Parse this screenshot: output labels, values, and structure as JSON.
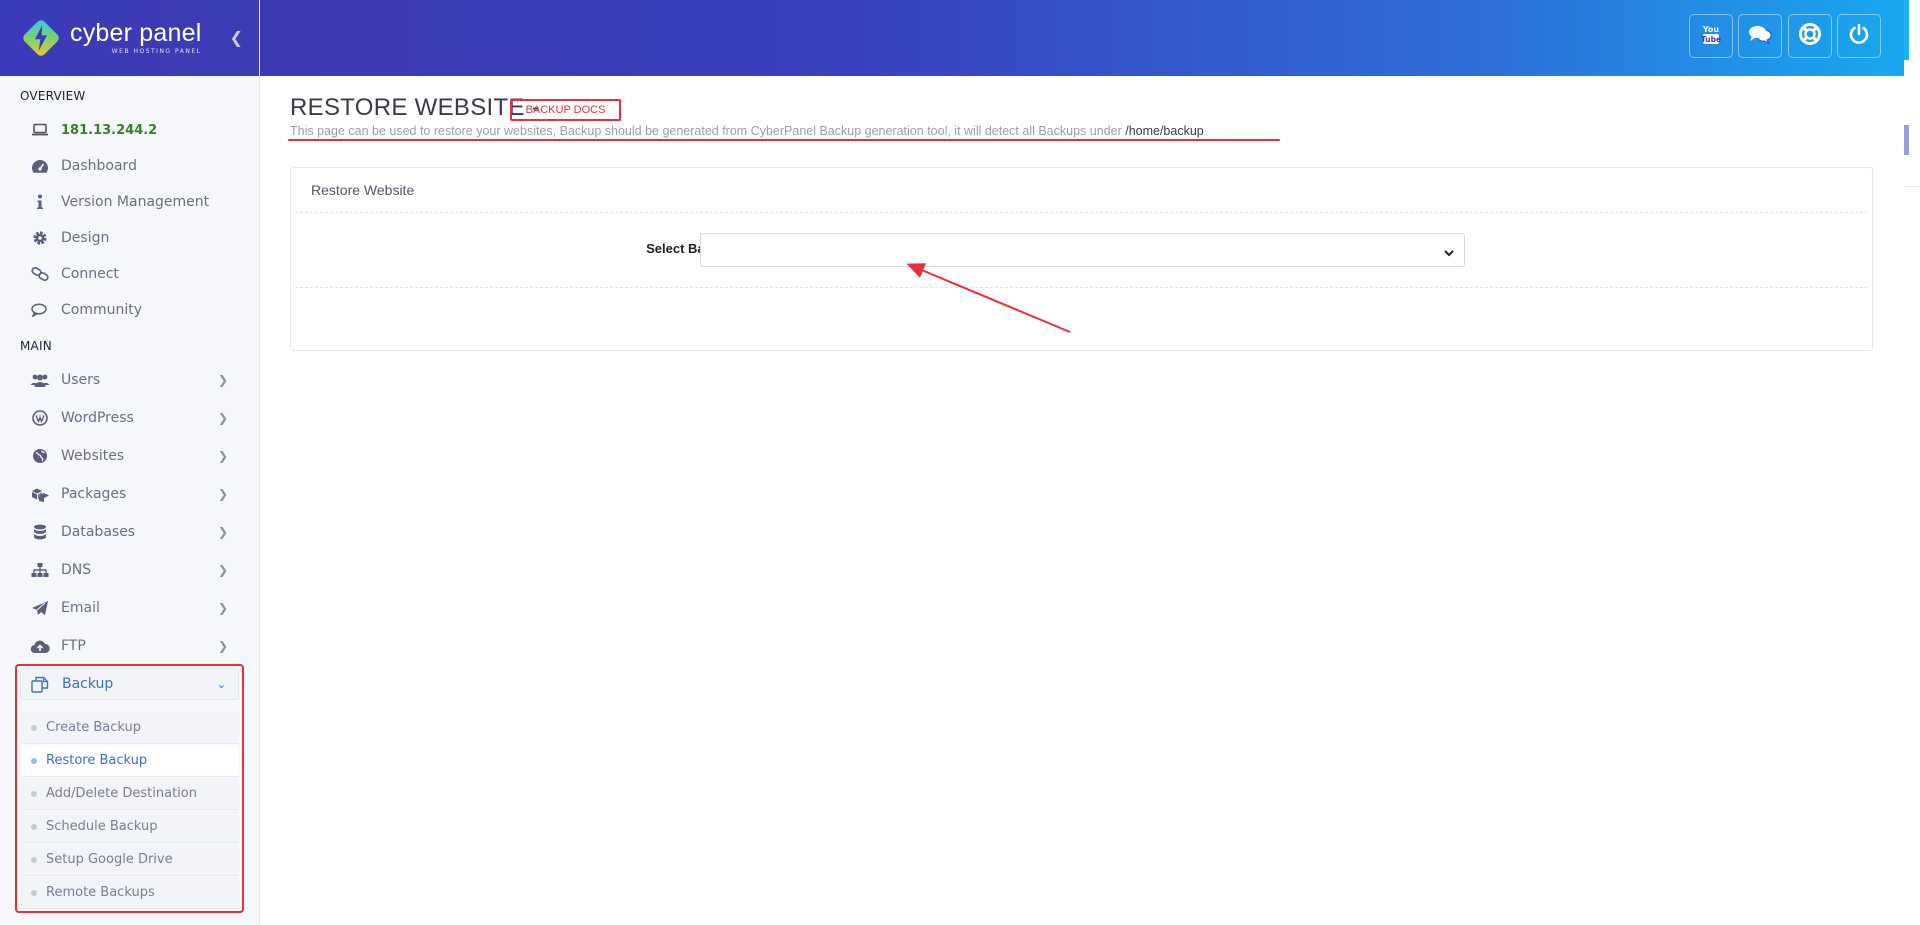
{
  "brand": {
    "title": "cyber panel",
    "subtitle": "WEB HOSTING PANEL",
    "collapse_icon": "chevron-left-icon"
  },
  "sidebar": {
    "overview_label": "OVERVIEW",
    "main_label": "MAIN",
    "ip": "181.13.244.2",
    "overview_items": [
      {
        "label": "Dashboard",
        "icon": "dashboard-icon"
      },
      {
        "label": "Version Management",
        "icon": "info-icon"
      },
      {
        "label": "Design",
        "icon": "gear-icon"
      },
      {
        "label": "Connect",
        "icon": "link-icon"
      },
      {
        "label": "Community",
        "icon": "chat-icon"
      }
    ],
    "main_items": [
      {
        "label": "Users",
        "icon": "users-icon"
      },
      {
        "label": "WordPress",
        "icon": "wordpress-icon"
      },
      {
        "label": "Websites",
        "icon": "globe-icon"
      },
      {
        "label": "Packages",
        "icon": "packages-icon"
      },
      {
        "label": "Databases",
        "icon": "database-icon"
      },
      {
        "label": "DNS",
        "icon": "sitemap-icon"
      },
      {
        "label": "Email",
        "icon": "paper-plane-icon"
      },
      {
        "label": "FTP",
        "icon": "cloud-upload-icon"
      }
    ],
    "backup": {
      "label": "Backup",
      "icon": "copy-icon",
      "items": [
        {
          "label": "Create Backup"
        },
        {
          "label": "Restore Backup"
        },
        {
          "label": "Add/Delete Destination"
        },
        {
          "label": "Schedule Backup"
        },
        {
          "label": "Setup Google Drive"
        },
        {
          "label": "Remote Backups"
        }
      ],
      "active_item": "Restore Backup"
    }
  },
  "header": {
    "buttons": [
      {
        "name": "youtube",
        "icon": "youtube-icon"
      },
      {
        "name": "chat",
        "icon": "chat-bubbles-icon"
      },
      {
        "name": "support",
        "icon": "life-ring-icon"
      },
      {
        "name": "logout",
        "icon": "power-icon"
      }
    ]
  },
  "main": {
    "title": "RESTORE WEBSITE -",
    "docs_link": "BACKUP DOCS",
    "description": "This page can be used to restore your websites, Backup should be generated from CyberPanel Backup generation tool, it will detect all Backups under",
    "description_path": "/home/backup",
    "panel": {
      "title": "Restore Website",
      "select_label": "Select Backup",
      "select_value": ""
    }
  },
  "colors": {
    "accent": "#3a6fd8",
    "header_start": "#3d3ab1",
    "header_end": "#18a8ef",
    "annotation_red": "#e8303a",
    "ip_green": "#3a7d2c"
  }
}
